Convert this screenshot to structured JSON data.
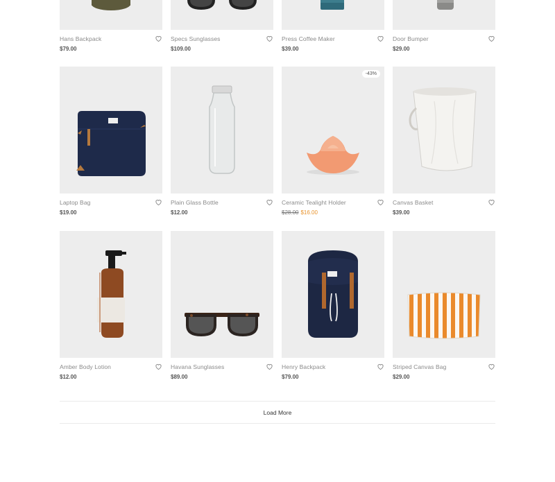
{
  "products": [
    {
      "name": "Hans Backpack",
      "price": "$79.00",
      "icon": "backpack"
    },
    {
      "name": "Specs Sunglasses",
      "price": "$109.00",
      "icon": "sunglasses"
    },
    {
      "name": "Press Coffee Maker",
      "price": "$39.00",
      "icon": "coffee-maker"
    },
    {
      "name": "Door Bumper",
      "price": "$29.00",
      "icon": "door-bumper"
    },
    {
      "name": "Laptop Bag",
      "price": "$19.00",
      "icon": "laptop-bag"
    },
    {
      "name": "Plain Glass Bottle",
      "price": "$12.00",
      "icon": "glass-bottle"
    },
    {
      "name": "Ceramic Tealight Holder",
      "price_old": "$28.00",
      "price": "$16.00",
      "badge": "-43%",
      "icon": "tealight-holder"
    },
    {
      "name": "Canvas Basket",
      "price": "$39.00",
      "icon": "canvas-basket"
    },
    {
      "name": "Amber Body Lotion",
      "price": "$12.00",
      "icon": "lotion-bottle"
    },
    {
      "name": "Havana Sunglasses",
      "price": "$89.00",
      "icon": "sunglasses"
    },
    {
      "name": "Henry Backpack",
      "price": "$79.00",
      "icon": "backpack"
    },
    {
      "name": "Striped Canvas Bag",
      "price": "$29.00",
      "icon": "pouch"
    }
  ],
  "load_more": {
    "label": "Load More"
  },
  "colors": {
    "sale": "#e8932d",
    "image_bg": "#ededed"
  }
}
